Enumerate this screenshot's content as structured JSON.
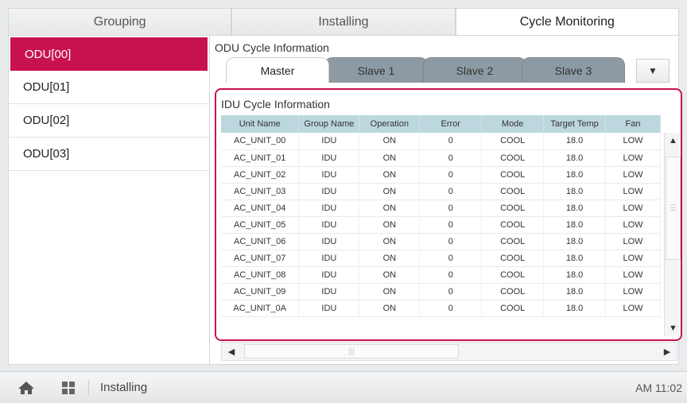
{
  "top_tabs": [
    "Grouping",
    "Installing",
    "Cycle Monitoring"
  ],
  "active_top_tab": "Cycle Monitoring",
  "sidebar": {
    "items": [
      "ODU[00]",
      "ODU[01]",
      "ODU[02]",
      "ODU[03]"
    ],
    "active": "ODU[00]"
  },
  "odu": {
    "title": "ODU Cycle Information",
    "tabs": [
      "Master",
      "Slave 1",
      "Slave 2",
      "Slave 3"
    ],
    "active_tab": "Master",
    "dropdown_icon": "chevron-down-icon"
  },
  "idu": {
    "title": "IDU Cycle Information",
    "columns": [
      "Unit Name",
      "Group Name",
      "Operation",
      "Error",
      "Mode",
      "Target Temp",
      "Fan"
    ],
    "rows": [
      [
        "AC_UNIT_00",
        "IDU",
        "ON",
        "0",
        "COOL",
        "18.0",
        "LOW"
      ],
      [
        "AC_UNIT_01",
        "IDU",
        "ON",
        "0",
        "COOL",
        "18.0",
        "LOW"
      ],
      [
        "AC_UNIT_02",
        "IDU",
        "ON",
        "0",
        "COOL",
        "18.0",
        "LOW"
      ],
      [
        "AC_UNIT_03",
        "IDU",
        "ON",
        "0",
        "COOL",
        "18.0",
        "LOW"
      ],
      [
        "AC_UNIT_04",
        "IDU",
        "ON",
        "0",
        "COOL",
        "18.0",
        "LOW"
      ],
      [
        "AC_UNIT_05",
        "IDU",
        "ON",
        "0",
        "COOL",
        "18.0",
        "LOW"
      ],
      [
        "AC_UNIT_06",
        "IDU",
        "ON",
        "0",
        "COOL",
        "18.0",
        "LOW"
      ],
      [
        "AC_UNIT_07",
        "IDU",
        "ON",
        "0",
        "COOL",
        "18.0",
        "LOW"
      ],
      [
        "AC_UNIT_08",
        "IDU",
        "ON",
        "0",
        "COOL",
        "18.0",
        "LOW"
      ],
      [
        "AC_UNIT_09",
        "IDU",
        "ON",
        "0",
        "COOL",
        "18.0",
        "LOW"
      ],
      [
        "AC_UNIT_0A",
        "IDU",
        "ON",
        "0",
        "COOL",
        "18.0",
        "LOW"
      ]
    ]
  },
  "bottom": {
    "breadcrumb": "Installing",
    "time": "AM 11:02"
  },
  "colors": {
    "accent": "#c8124e",
    "header": "#bcd7de",
    "inactive_tab": "#8e9aa3"
  }
}
